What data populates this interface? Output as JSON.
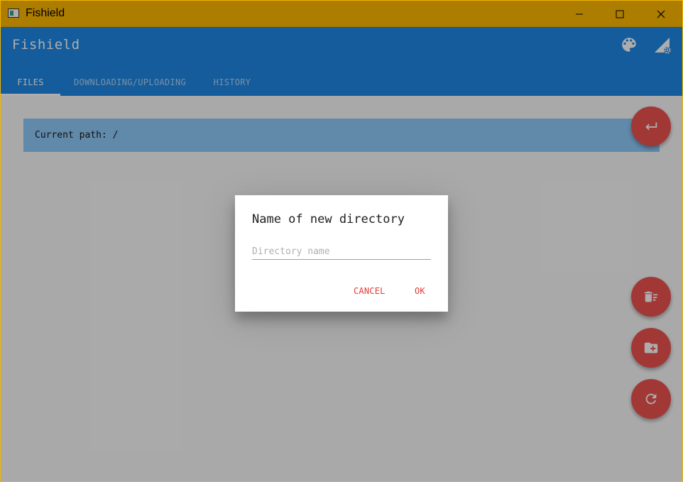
{
  "window": {
    "title": "Fishield",
    "controls": [
      "minimize",
      "maximize",
      "close"
    ]
  },
  "appbar": {
    "title": "Fishield",
    "actions": [
      {
        "icon": "palette-icon"
      },
      {
        "icon": "network-settings-icon"
      }
    ],
    "tabs": [
      {
        "label": "FILES",
        "active": true
      },
      {
        "label": "DOWNLOADING/UPLOADING",
        "active": false
      },
      {
        "label": "HISTORY",
        "active": false
      }
    ]
  },
  "content": {
    "current_path": "Current path: /"
  },
  "fabs": [
    {
      "icon": "back-arrow-icon"
    },
    {
      "icon": "delete-sweep-icon"
    },
    {
      "icon": "new-folder-icon"
    },
    {
      "icon": "refresh-icon"
    }
  ],
  "dialog": {
    "title": "Name of new directory",
    "input_value": "",
    "input_placeholder": "Directory name",
    "cancel_label": "CANCEL",
    "ok_label": "OK"
  },
  "colors": {
    "titlebar": "#ffb900",
    "appbar": "#1e88e5",
    "path_bar": "#90caf9",
    "fab": "#ef5350",
    "dialog_button": "#e53935"
  }
}
